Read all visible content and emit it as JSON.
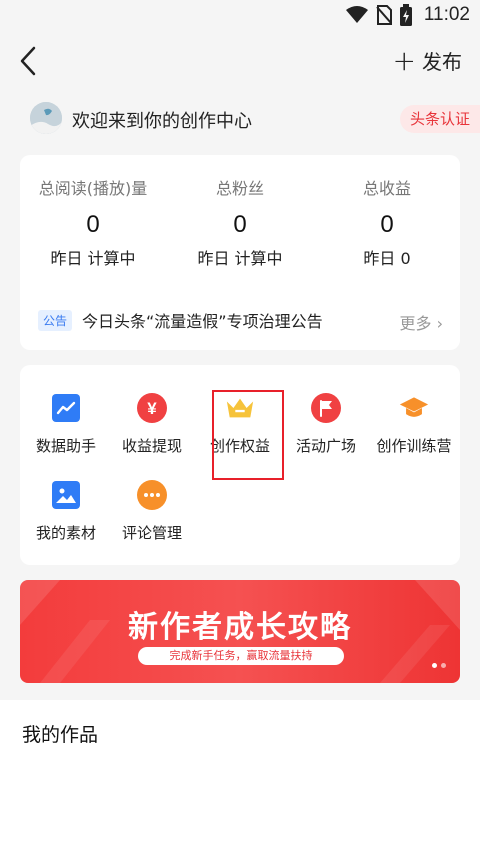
{
  "status_bar": {
    "time": "11:02",
    "icons": [
      "wifi-icon",
      "no-sim-icon",
      "battery-charging-icon"
    ]
  },
  "header": {
    "back_icon": "chevron-left-icon",
    "publish_label": "发布",
    "publish_icon": "plus-icon"
  },
  "welcome": {
    "text": "欢迎来到你的创作中心",
    "badge": "头条认证"
  },
  "stats": [
    {
      "title": "总阅读(播放)量",
      "value": "0",
      "sub": "昨日 计算中"
    },
    {
      "title": "总粉丝",
      "value": "0",
      "sub": "昨日 计算中"
    },
    {
      "title": "总收益",
      "value": "0",
      "sub": "昨日 0"
    }
  ],
  "notice": {
    "tag": "公告",
    "text": "今日头条“流量造假”专项治理公告",
    "more": "更多"
  },
  "tools": [
    {
      "label": "数据助手",
      "icon": "chart-icon",
      "color": "#2f7cf6"
    },
    {
      "label": "收益提现",
      "icon": "yuan-icon",
      "color": "#f04142"
    },
    {
      "label": "创作权益",
      "icon": "crown-icon",
      "color": "#f6c33b"
    },
    {
      "label": "活动广场",
      "icon": "flag-icon",
      "color": "#f04142"
    },
    {
      "label": "创作训练营",
      "icon": "graduation-cap-icon",
      "color": "#f7902a"
    },
    {
      "label": "我的素材",
      "icon": "image-icon",
      "color": "#2f7cf6"
    },
    {
      "label": "评论管理",
      "icon": "comment-icon",
      "color": "#f7902a"
    }
  ],
  "banner": {
    "title": "新作者成长攻略",
    "subtitle": "完成新手任务，赢取流量扶持"
  },
  "works": {
    "title": "我的作品"
  }
}
